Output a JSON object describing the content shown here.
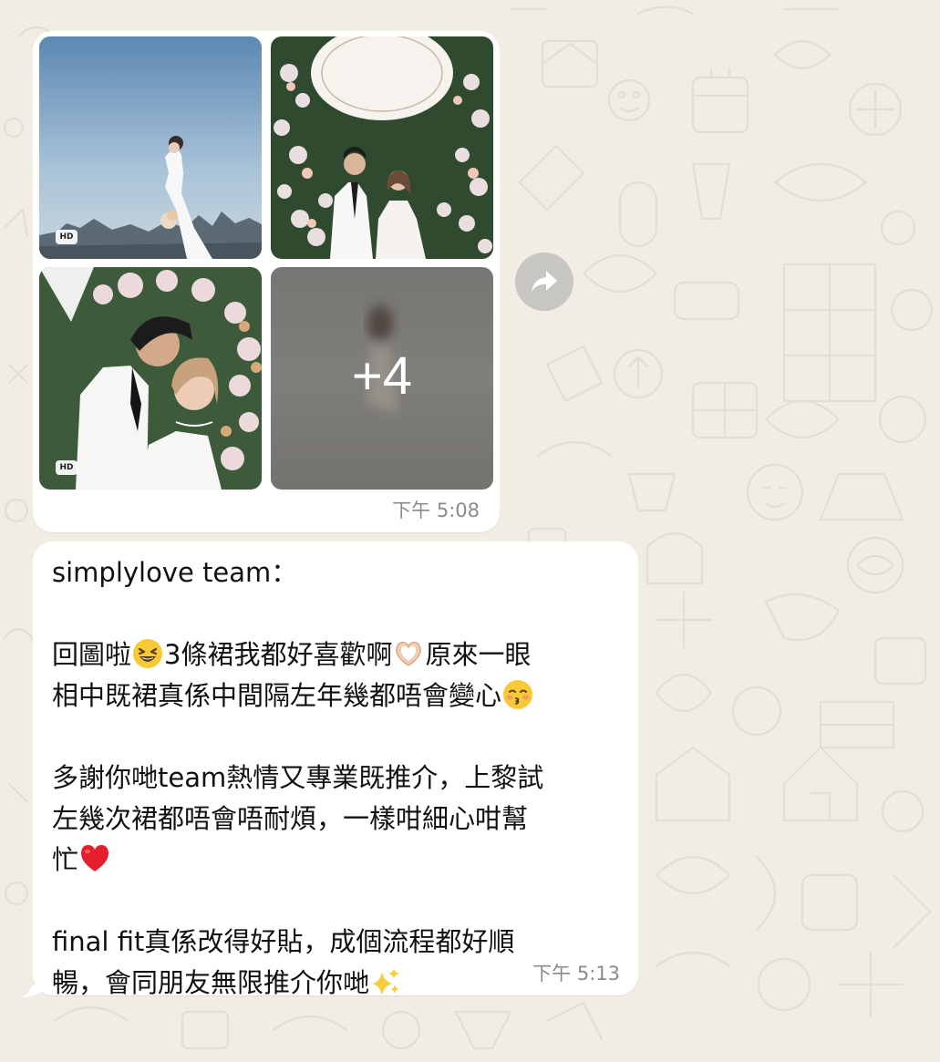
{
  "chat": {
    "album_message": {
      "hd_label": "HD",
      "more_count": "+4",
      "time": "下午 5:08"
    },
    "text_message": {
      "sender": "simplylove team：",
      "line1_a": "回圖啦",
      "line1_b": "3條裙我都好喜歡啊",
      "line1_c": "原來一眼",
      "line2": "相中既裙真係中間隔左年幾都唔會變心",
      "line3": "多謝你哋team熱情又專業既推介，上黎試",
      "line4": "左幾次裙都唔會唔耐煩，一樣咁細心咁幫",
      "line5": "忙",
      "line6": "final fit真係改得好貼，成個流程都好順",
      "line7": "暢，會同朋友無限推介你哋",
      "time": "下午 5:13",
      "emojis": [
        "laughing-face",
        "heart-hands",
        "kissing-face",
        "red-heart",
        "sparkles"
      ]
    },
    "icons": [
      "forward-icon"
    ],
    "colors": {
      "wallpaper": "#f1ede5",
      "bubble": "#ffffff",
      "timestamp": "#8a8a8a"
    }
  }
}
